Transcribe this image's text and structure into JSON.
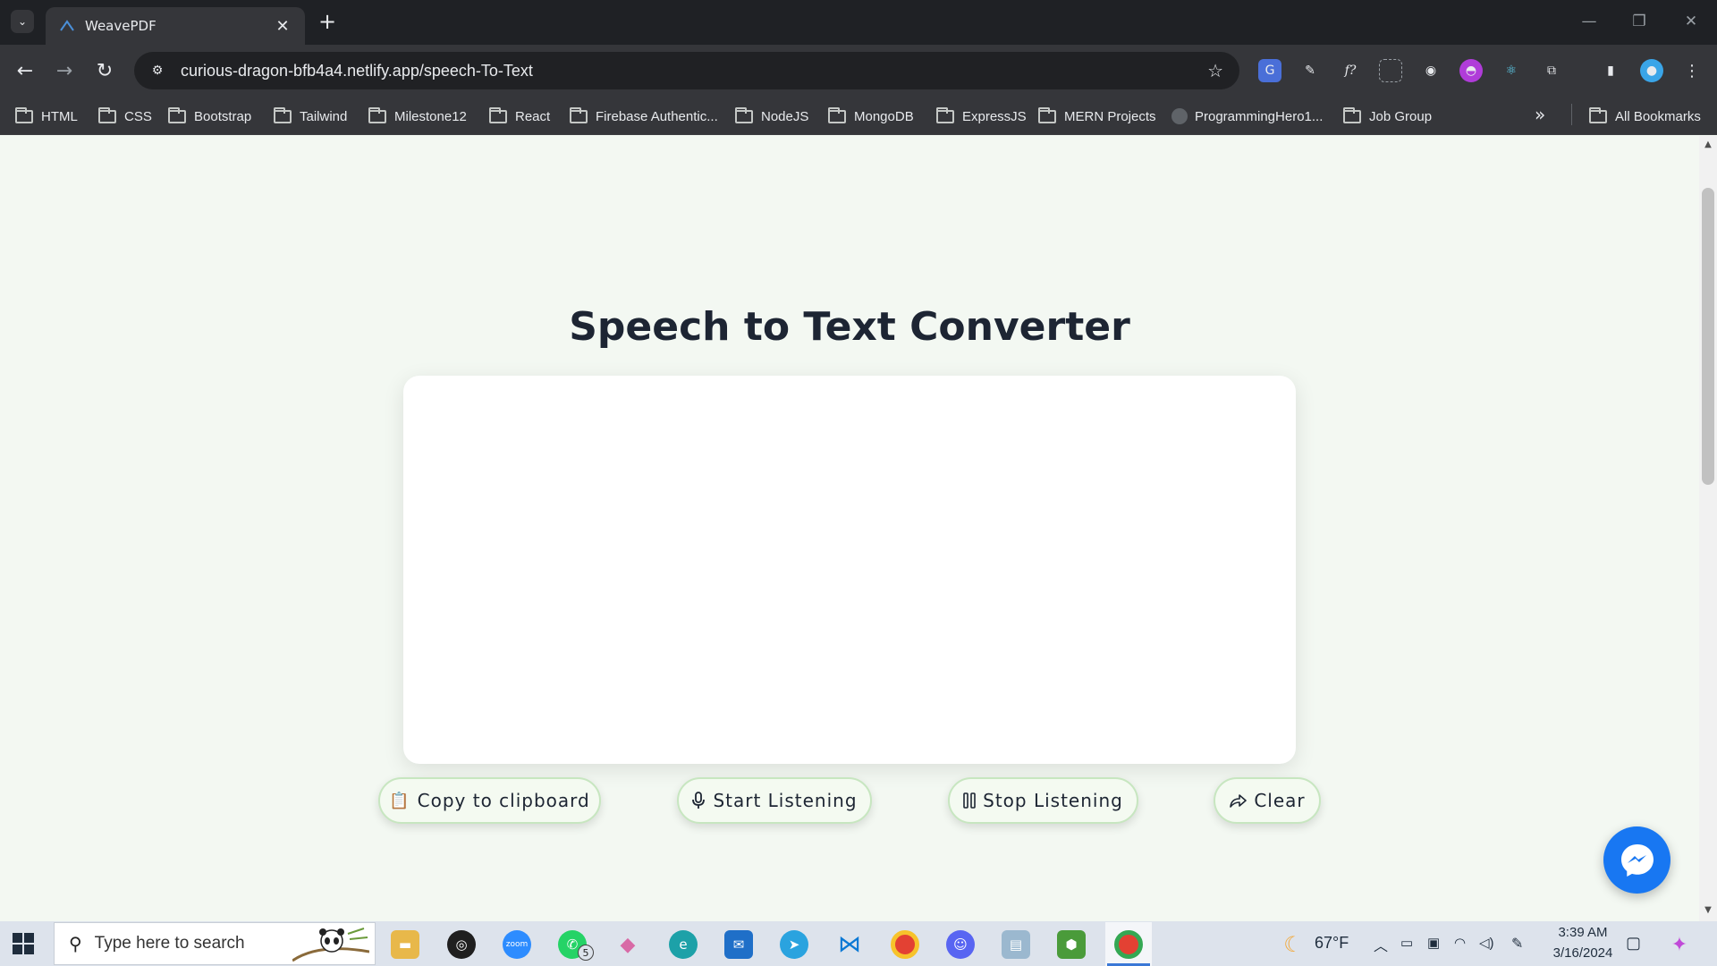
{
  "browser": {
    "tab_title": "WeavePDF",
    "tab_close": "✕",
    "new_tab": "+",
    "url": "curious-dragon-bfb4a4.netlify.app/speech-To-Text",
    "bookmarks": [
      {
        "label": "HTML",
        "icon": "folder-icon"
      },
      {
        "label": "CSS",
        "icon": "folder-icon"
      },
      {
        "label": "Bootstrap",
        "icon": "folder-icon"
      },
      {
        "label": "Tailwind",
        "icon": "folder-icon"
      },
      {
        "label": "Milestone12",
        "icon": "folder-icon"
      },
      {
        "label": "React",
        "icon": "folder-icon"
      },
      {
        "label": "Firebase Authentic...",
        "icon": "folder-icon"
      },
      {
        "label": "NodeJS",
        "icon": "folder-icon"
      },
      {
        "label": "MongoDB",
        "icon": "folder-icon"
      },
      {
        "label": "ExpressJS",
        "icon": "folder-icon"
      },
      {
        "label": "MERN Projects",
        "icon": "folder-icon"
      },
      {
        "label": "ProgrammingHero1...",
        "icon": "github-icon"
      },
      {
        "label": "Job Group",
        "icon": "folder-icon"
      }
    ],
    "bookmarks_more": "»",
    "all_bookmarks": "All Bookmarks",
    "ext_fx_label": "f?"
  },
  "page": {
    "heading": "Speech to Text Converter",
    "textarea_value": "",
    "buttons": {
      "copy": "Copy to clipboard",
      "start": "Start Listening",
      "stop": "Stop Listening",
      "clear": "Clear"
    }
  },
  "taskbar": {
    "search_placeholder": "Type here to search",
    "whatsapp_badge": "5",
    "weather_temp": "67°F",
    "time": "3:39 AM",
    "date": "3/16/2024"
  },
  "colors": {
    "page_bg": "#f3f8f2",
    "heading": "#1d2533",
    "button_border": "#c7e6c0",
    "messenger": "#1877f2"
  }
}
